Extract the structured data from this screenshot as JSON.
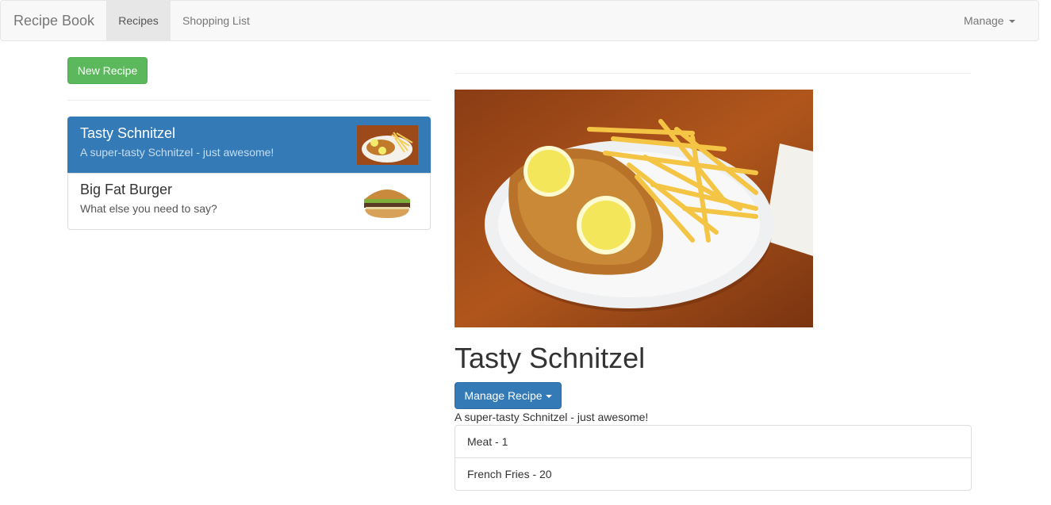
{
  "navbar": {
    "brand": "Recipe Book",
    "links": [
      "Recipes",
      "Shopping List"
    ],
    "manage_label": "Manage",
    "active_link": "Recipes"
  },
  "recipes_panel": {
    "new_button": "New Recipe",
    "items": [
      {
        "name": "Tasty Schnitzel",
        "description": "A super-tasty Schnitzel - just awesome!",
        "image_icon": "schnitzel-thumbnail",
        "active": true
      },
      {
        "name": "Big Fat Burger",
        "description": "What else you need to say?",
        "image_icon": "burger-thumbnail",
        "active": false
      }
    ]
  },
  "detail": {
    "title": "Tasty Schnitzel",
    "manage_button": "Manage Recipe",
    "description": "A super-tasty Schnitzel - just awesome!",
    "image_icon": "schnitzel-photo",
    "ingredients": [
      "Meat - 1",
      "French Fries - 20"
    ]
  },
  "colors": {
    "primary": "#337ab7",
    "success": "#5cb85c",
    "navbar_bg": "#f8f8f8",
    "nav_active_bg": "#e7e7e7"
  }
}
